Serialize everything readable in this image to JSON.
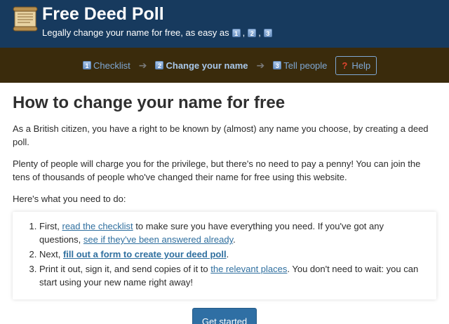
{
  "header": {
    "title": "Free Deed Poll",
    "tagline_prefix": "Legally change your name for free, as easy as",
    "tagline_badges": [
      "1",
      "2",
      "3"
    ],
    "tagline_sep_1": ",",
    "tagline_sep_2": ","
  },
  "nav": {
    "steps": [
      {
        "num": "1",
        "label": "Checklist",
        "active": false
      },
      {
        "num": "2",
        "label": "Change your name",
        "active": true
      },
      {
        "num": "3",
        "label": "Tell people",
        "active": false
      }
    ],
    "arrow": "➔",
    "help_icon": "?",
    "help_label": "Help"
  },
  "main": {
    "heading": "How to change your name for free",
    "para1": "As a British citizen, you have a right to be known by (almost) any name you choose, by creating a deed poll.",
    "para2": "Plenty of people will charge you for the privilege, but there's no need to pay a penny! You can join the tens of thousands of people who've changed their name for free using this website.",
    "para3": "Here's what you need to do:",
    "list": {
      "item1_pre": "First, ",
      "item1_link1": "read the checklist",
      "item1_mid": " to make sure you have everything you need. If you've got any questions, ",
      "item1_link2": "see if they've been answered already",
      "item1_post": ".",
      "item2_pre": "Next, ",
      "item2_link": "fill out a form to create your deed poll",
      "item2_post": ".",
      "item3_pre": "Print it out, sign it, and send copies of it to ",
      "item3_link": "the relevant places",
      "item3_post": ". You don't need to wait: you can start using your new name right away!"
    },
    "cta_label": "Get started"
  },
  "colors": {
    "header_bg": "#173a5e",
    "nav_bg": "#3a2b0c",
    "link": "#2f6f9f",
    "cta_bg": "#2f6fa4"
  },
  "icons": {
    "logo": "scroll-icon",
    "help": "question-mark-icon"
  }
}
